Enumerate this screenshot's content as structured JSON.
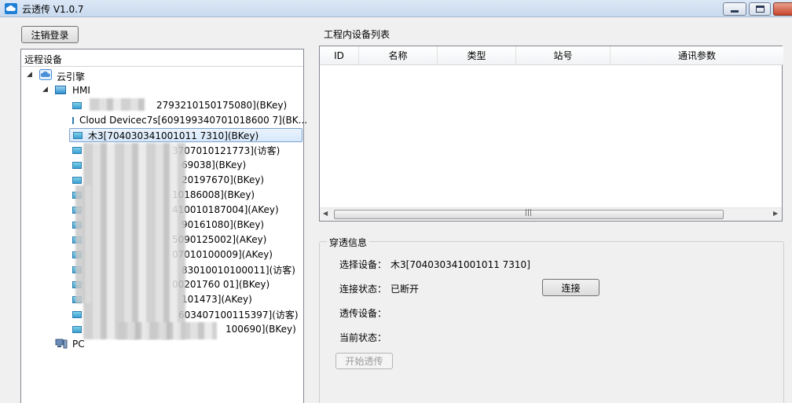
{
  "window": {
    "title": "云透传 V1.0.7"
  },
  "buttons": {
    "logout": "注销登录",
    "connect": "连接",
    "start": "开始透传"
  },
  "remote_devices": {
    "header": "远程设备",
    "root": "云引擎",
    "group": "HMI",
    "items": [
      "2793210150175080](BKey)",
      "Cloud Devicec7s[609199340701018600 7](BK...",
      "木3[704030341001011 7310](BKey)",
      "3707010121773](访客)",
      "69038](BKey)",
      "20197670](BKey)",
      "10186008](BKey)",
      "410010187004](AKey)",
      "90161080](BKey)",
      "5090125002](AKey)",
      "07010100009](AKey)",
      "83010010100011](访客)",
      "00201760 01](BKey)",
      "101473](AKey)",
      "603407100115397](访客)",
      "100690](BKey)"
    ],
    "pc": "PC"
  },
  "device_list": {
    "title": "工程内设备列表",
    "columns": [
      "ID",
      "名称",
      "类型",
      "站号",
      "通讯参数"
    ],
    "rows": []
  },
  "passthrough": {
    "title": "穿透信息",
    "select_label": "选择设备：",
    "select_value": "木3[704030341001011 7310]",
    "status_label": "连接状态：",
    "status_value": "已断开",
    "device_label": "透传设备：",
    "device_value": "",
    "current_label": "当前状态：",
    "current_value": ""
  }
}
